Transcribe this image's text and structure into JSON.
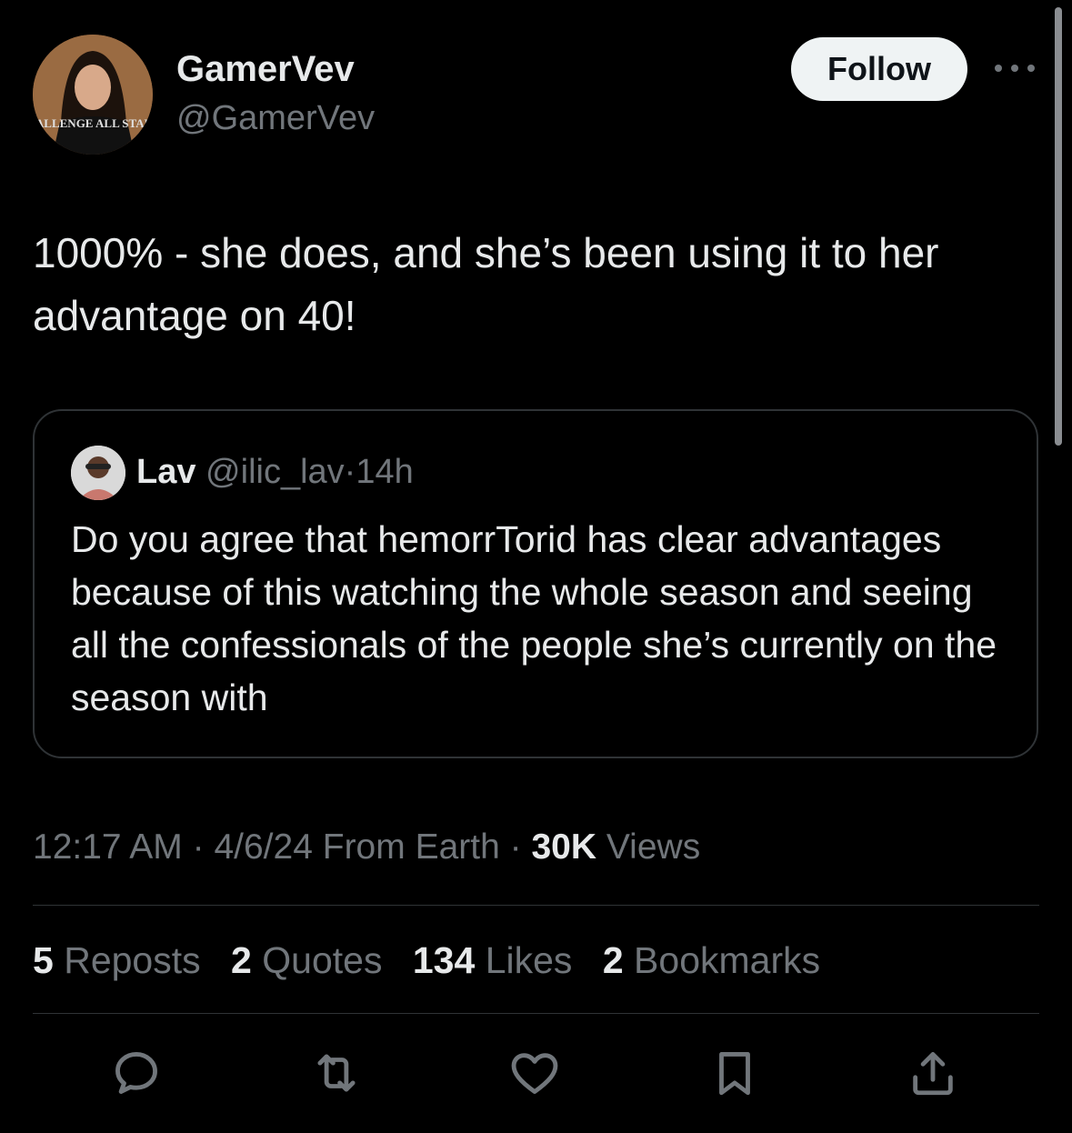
{
  "author": {
    "display_name": "GamerVev",
    "handle": "@GamerVev",
    "avatar_text": "HALLENGE ALL STARS"
  },
  "follow_label": "Follow",
  "tweet_text": "1000% - she does, and she’s been using it to her advantage on 40!",
  "quote": {
    "name": "Lav",
    "handle": "@ilic_lav",
    "separator": "·",
    "time": "14h",
    "text": "Do you agree that hemorrTorid has clear advantages because of this watching the whole season and seeing all the confessionals of the people she’s currently on the season with"
  },
  "meta": {
    "time": "12:17 AM",
    "sep1": "·",
    "date": "4/6/24",
    "location": "From Earth",
    "sep2": "·",
    "views_count": "30K",
    "views_label": "Views"
  },
  "stats": {
    "reposts_count": "5",
    "reposts_label": "Reposts",
    "quotes_count": "2",
    "quotes_label": "Quotes",
    "likes_count": "134",
    "likes_label": "Likes",
    "bookmarks_count": "2",
    "bookmarks_label": "Bookmarks"
  },
  "actions": [
    "reply-icon",
    "repost-icon",
    "like-icon",
    "bookmark-icon",
    "share-icon"
  ],
  "colors": {
    "background": "#000000",
    "text_primary": "#e7e9ea",
    "text_secondary": "#71767b",
    "border": "#2f3336",
    "follow_bg": "#eff3f4"
  }
}
